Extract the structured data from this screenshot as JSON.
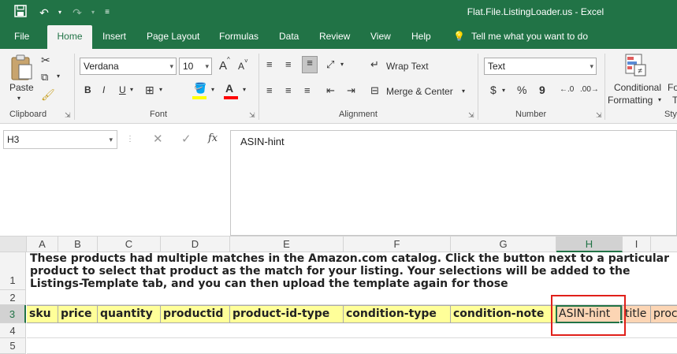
{
  "app": {
    "title": "Flat.File.ListingLoader.us  -  Excel"
  },
  "quick_access": {
    "save_icon": "save-icon",
    "undo_icon": "undo-icon",
    "redo_icon": "redo-icon",
    "customize_icon": "customize-icon"
  },
  "tabs": [
    "File",
    "Home",
    "Insert",
    "Page Layout",
    "Formulas",
    "Data",
    "Review",
    "View",
    "Help"
  ],
  "tell_me": "Tell me what you want to do",
  "ribbon": {
    "clipboard": {
      "label": "Clipboard",
      "paste": "Paste"
    },
    "font": {
      "label": "Font",
      "name": "Verdana",
      "size": "10",
      "bold": "B",
      "italic": "I",
      "underline": "U",
      "grow": "A",
      "shrink": "A"
    },
    "alignment": {
      "label": "Alignment",
      "wrap_text": "Wrap Text",
      "merge_center": "Merge & Center"
    },
    "number": {
      "label": "Number",
      "format": "Text",
      "currency": "$",
      "percent": "%",
      "comma": "9"
    },
    "styles": {
      "label": "Sty",
      "conditional_line1": "Conditional",
      "conditional_line2": "Formatting",
      "format_line1": "Fo",
      "format_line2": "T"
    }
  },
  "formula_bar": {
    "name_box": "H3",
    "fx": "fx",
    "content": "ASIN-hint"
  },
  "grid": {
    "columns": [
      "A",
      "B",
      "C",
      "D",
      "E",
      "F",
      "G",
      "H",
      "I"
    ],
    "rows": [
      "1",
      "2",
      "3",
      "4",
      "5"
    ],
    "row1_text": "These products had multiple matches in the Amazon.com catalog. Click the button next to a particular product to select  that product as the match for your listing. Your selections will be added to the Listings-Template tab, and you can then upload the template again for those",
    "row3": [
      "sku",
      "price",
      "quantity",
      "productid",
      "product-id-type",
      "condition-type",
      "condition-note",
      "ASIN-hint",
      "title",
      "proc"
    ]
  },
  "colors": {
    "excel_green": "#217346",
    "header_yellow": "#ffff99",
    "header_orange": "#fcd5b4",
    "highlight_red": "#e0201a"
  }
}
